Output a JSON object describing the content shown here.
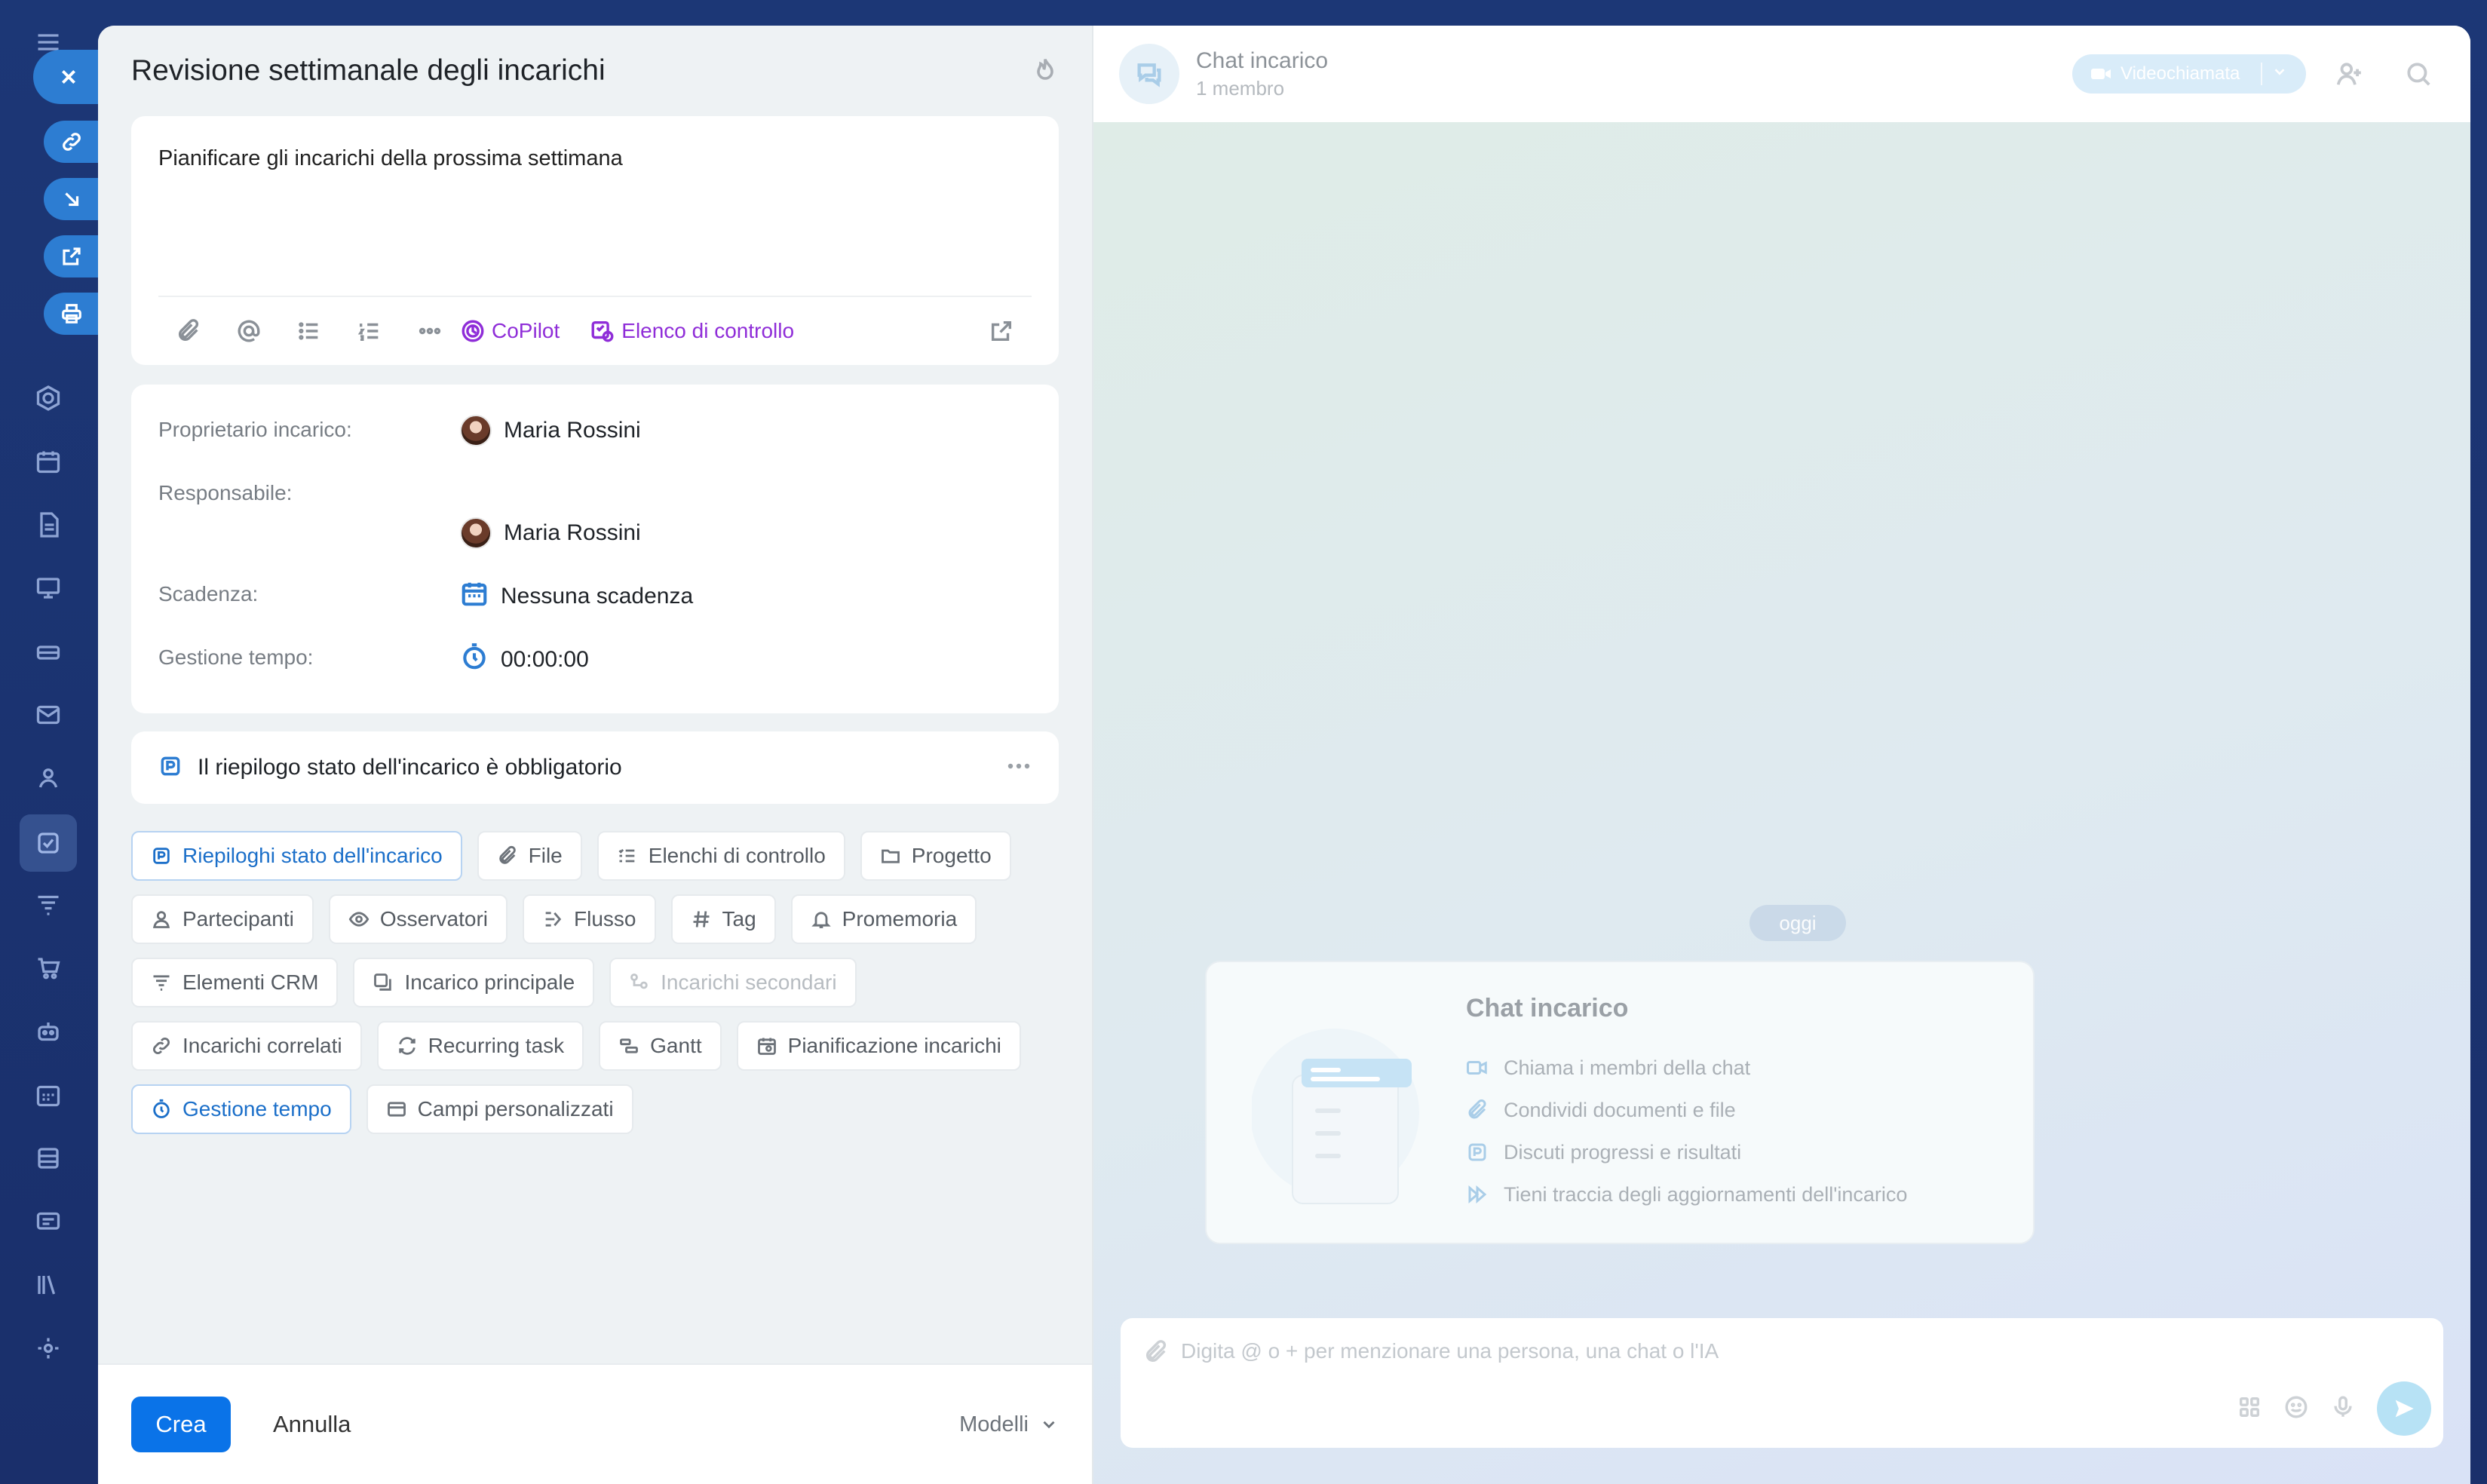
{
  "form": {
    "title": "Revisione settimanale degli incarichi",
    "description": "Pianificare gli incarichi della prossima settimana",
    "toolbar": {
      "copilot_label": "CoPilot",
      "checklist_label": "Elenco di controllo"
    },
    "fields": {
      "owner_label": "Proprietario incarico:",
      "owner_value": "Maria Rossini",
      "assignee_label": "Responsabile:",
      "assignee_value": "Maria Rossini",
      "deadline_label": "Scadenza:",
      "deadline_value": "Nessuna scadenza",
      "time_label": "Gestione tempo:",
      "time_value": "00:00:00"
    },
    "status_summary": "Il riepilogo stato dell'incarico è obbligatorio",
    "chips": [
      {
        "label": "Riepiloghi stato dell'incarico",
        "icon": "status-summary-icon",
        "state": "active"
      },
      {
        "label": "File",
        "icon": "paperclip-icon",
        "state": "normal"
      },
      {
        "label": "Elenchi di controllo",
        "icon": "checklist-icon",
        "state": "normal"
      },
      {
        "label": "Progetto",
        "icon": "folder-icon",
        "state": "normal"
      },
      {
        "label": "Partecipanti",
        "icon": "person-icon",
        "state": "normal"
      },
      {
        "label": "Osservatori",
        "icon": "eye-icon",
        "state": "normal"
      },
      {
        "label": "Flusso",
        "icon": "flow-icon",
        "state": "normal"
      },
      {
        "label": "Tag",
        "icon": "hash-icon",
        "state": "normal"
      },
      {
        "label": "Promemoria",
        "icon": "bell-icon",
        "state": "normal"
      },
      {
        "label": "Elementi CRM",
        "icon": "crm-icon",
        "state": "normal"
      },
      {
        "label": "Incarico principale",
        "icon": "parent-task-icon",
        "state": "normal"
      },
      {
        "label": "Incarichi secondari",
        "icon": "subtask-icon",
        "state": "disabled"
      },
      {
        "label": "Incarichi correlati",
        "icon": "link-icon",
        "state": "normal"
      },
      {
        "label": "Recurring task",
        "icon": "repeat-icon",
        "state": "normal"
      },
      {
        "label": "Gantt",
        "icon": "gantt-icon",
        "state": "normal"
      },
      {
        "label": "Pianificazione incarichi",
        "icon": "calendar-gear-icon",
        "state": "normal"
      },
      {
        "label": "Gestione tempo",
        "icon": "stopwatch-icon",
        "state": "active"
      },
      {
        "label": "Campi personalizzati",
        "icon": "custom-fields-icon",
        "state": "normal"
      }
    ],
    "footer": {
      "create_label": "Crea",
      "cancel_label": "Annulla",
      "templates_label": "Modelli"
    }
  },
  "chat": {
    "title": "Chat incarico",
    "subtitle": "1 membro",
    "video_label": "Videochiamata",
    "date_pill": "oggi",
    "welcome": {
      "title": "Chat incarico",
      "items": [
        "Chiama i membri della chat",
        "Condividi documenti e file",
        "Discuti progressi e risultati",
        "Tieni traccia degli aggiornamenti dell'incarico"
      ]
    },
    "composer_placeholder": "Digita @ o + per menzionare una persona, una chat o l'IA"
  },
  "colors": {
    "accent": "#0a73e8",
    "copilot": "#8f2dd8",
    "background": "#1e3a78"
  }
}
